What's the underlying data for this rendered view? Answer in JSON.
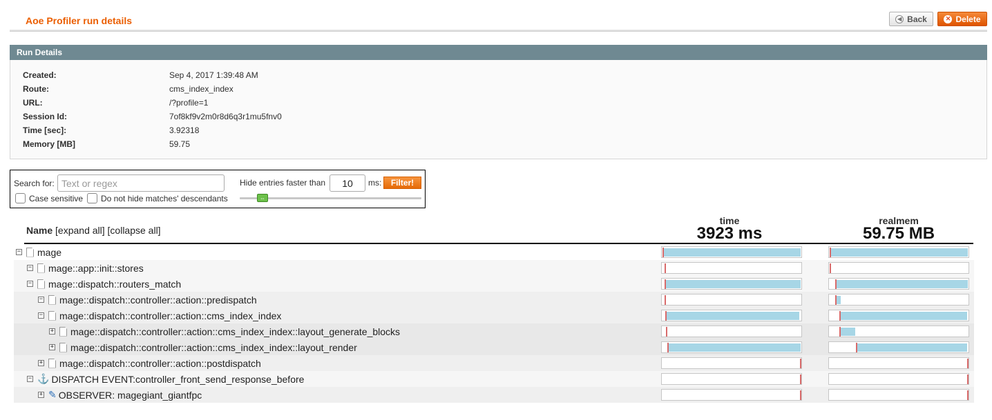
{
  "header": {
    "title": "Aoe Profiler run details",
    "back_label": "Back",
    "delete_label": "Delete"
  },
  "run_details": {
    "heading": "Run Details",
    "rows": [
      {
        "label": "Created:",
        "value": "Sep 4, 2017 1:39:48 AM"
      },
      {
        "label": "Route:",
        "value": "cms_index_index"
      },
      {
        "label": "URL:",
        "value": "/?profile=1"
      },
      {
        "label": "Session Id:",
        "value": "7of8kf9v2m0r8d6q3r1mu5fnv0"
      },
      {
        "label": "Time [sec]:",
        "value": "3.92318"
      },
      {
        "label": "Memory [MB]",
        "value": "59.75"
      }
    ]
  },
  "filter": {
    "search_label": "Search for:",
    "search_placeholder": "Text or regex",
    "hide_label": "Hide entries faster than",
    "hide_value": "10",
    "ms_label": "ms:",
    "filter_button": "Filter!",
    "case_sensitive_label": "Case sensitive",
    "descendants_label": "Do not hide matches' descendants"
  },
  "tree": {
    "name_header": "Name",
    "expand_all": "[expand all]",
    "collapse_all": "[collapse all]",
    "time_title": "time",
    "time_total": "3923 ms",
    "mem_title": "realmem",
    "mem_total": "59.75 MB",
    "rows": [
      {
        "label": "mage",
        "depth": 0,
        "toggle": "−",
        "icon": "file",
        "time": {
          "start": 0.0,
          "dur": 0.995
        },
        "mem": {
          "start": 0.0,
          "dur": 0.995
        }
      },
      {
        "label": "mage::app::init::stores",
        "depth": 1,
        "toggle": "−",
        "icon": "file",
        "time": {
          "start": 0.015,
          "dur": 0.0
        },
        "mem": {
          "start": 0.0,
          "dur": 0.0
        }
      },
      {
        "label": "mage::dispatch::routers_match",
        "depth": 1,
        "toggle": "−",
        "icon": "file",
        "time": {
          "start": 0.015,
          "dur": 0.98
        },
        "mem": {
          "start": 0.04,
          "dur": 0.955
        }
      },
      {
        "label": "mage::dispatch::controller::action::predispatch",
        "depth": 2,
        "toggle": "−",
        "icon": "file",
        "time": {
          "start": 0.015,
          "dur": 0.0
        },
        "mem": {
          "start": 0.04,
          "dur": 0.035
        }
      },
      {
        "label": "mage::dispatch::controller::action::cms_index_index",
        "depth": 2,
        "toggle": "−",
        "icon": "file",
        "time": {
          "start": 0.02,
          "dur": 0.965
        },
        "mem": {
          "start": 0.07,
          "dur": 0.92
        }
      },
      {
        "label": "mage::dispatch::controller::action::cms_index_index::layout_generate_blocks",
        "depth": 3,
        "toggle": "+",
        "icon": "file",
        "time": {
          "start": 0.025,
          "dur": 0.0
        },
        "mem": {
          "start": 0.07,
          "dur": 0.11
        }
      },
      {
        "label": "mage::dispatch::controller::action::cms_index_index::layout_render",
        "depth": 3,
        "toggle": "+",
        "icon": "file",
        "time": {
          "start": 0.035,
          "dur": 0.96
        },
        "mem": {
          "start": 0.19,
          "dur": 0.8
        }
      },
      {
        "label": "mage::dispatch::controller::action::postdispatch",
        "depth": 2,
        "toggle": "+",
        "icon": "file",
        "time": {
          "start": 0.995,
          "dur": 0.0
        },
        "mem": {
          "start": 0.995,
          "dur": 0.0
        }
      },
      {
        "label": "DISPATCH EVENT:controller_front_send_response_before",
        "depth": 1,
        "toggle": "−",
        "icon": "anchor",
        "time": {
          "start": 0.995,
          "dur": 0.0
        },
        "mem": {
          "start": 0.995,
          "dur": 0.0
        }
      },
      {
        "label": "OBSERVER: magegiant_giantfpc",
        "depth": 2,
        "toggle": "+",
        "icon": "pin",
        "time": {
          "start": 0.995,
          "dur": 0.0
        },
        "mem": {
          "start": 0.995,
          "dur": 0.0
        }
      }
    ]
  }
}
